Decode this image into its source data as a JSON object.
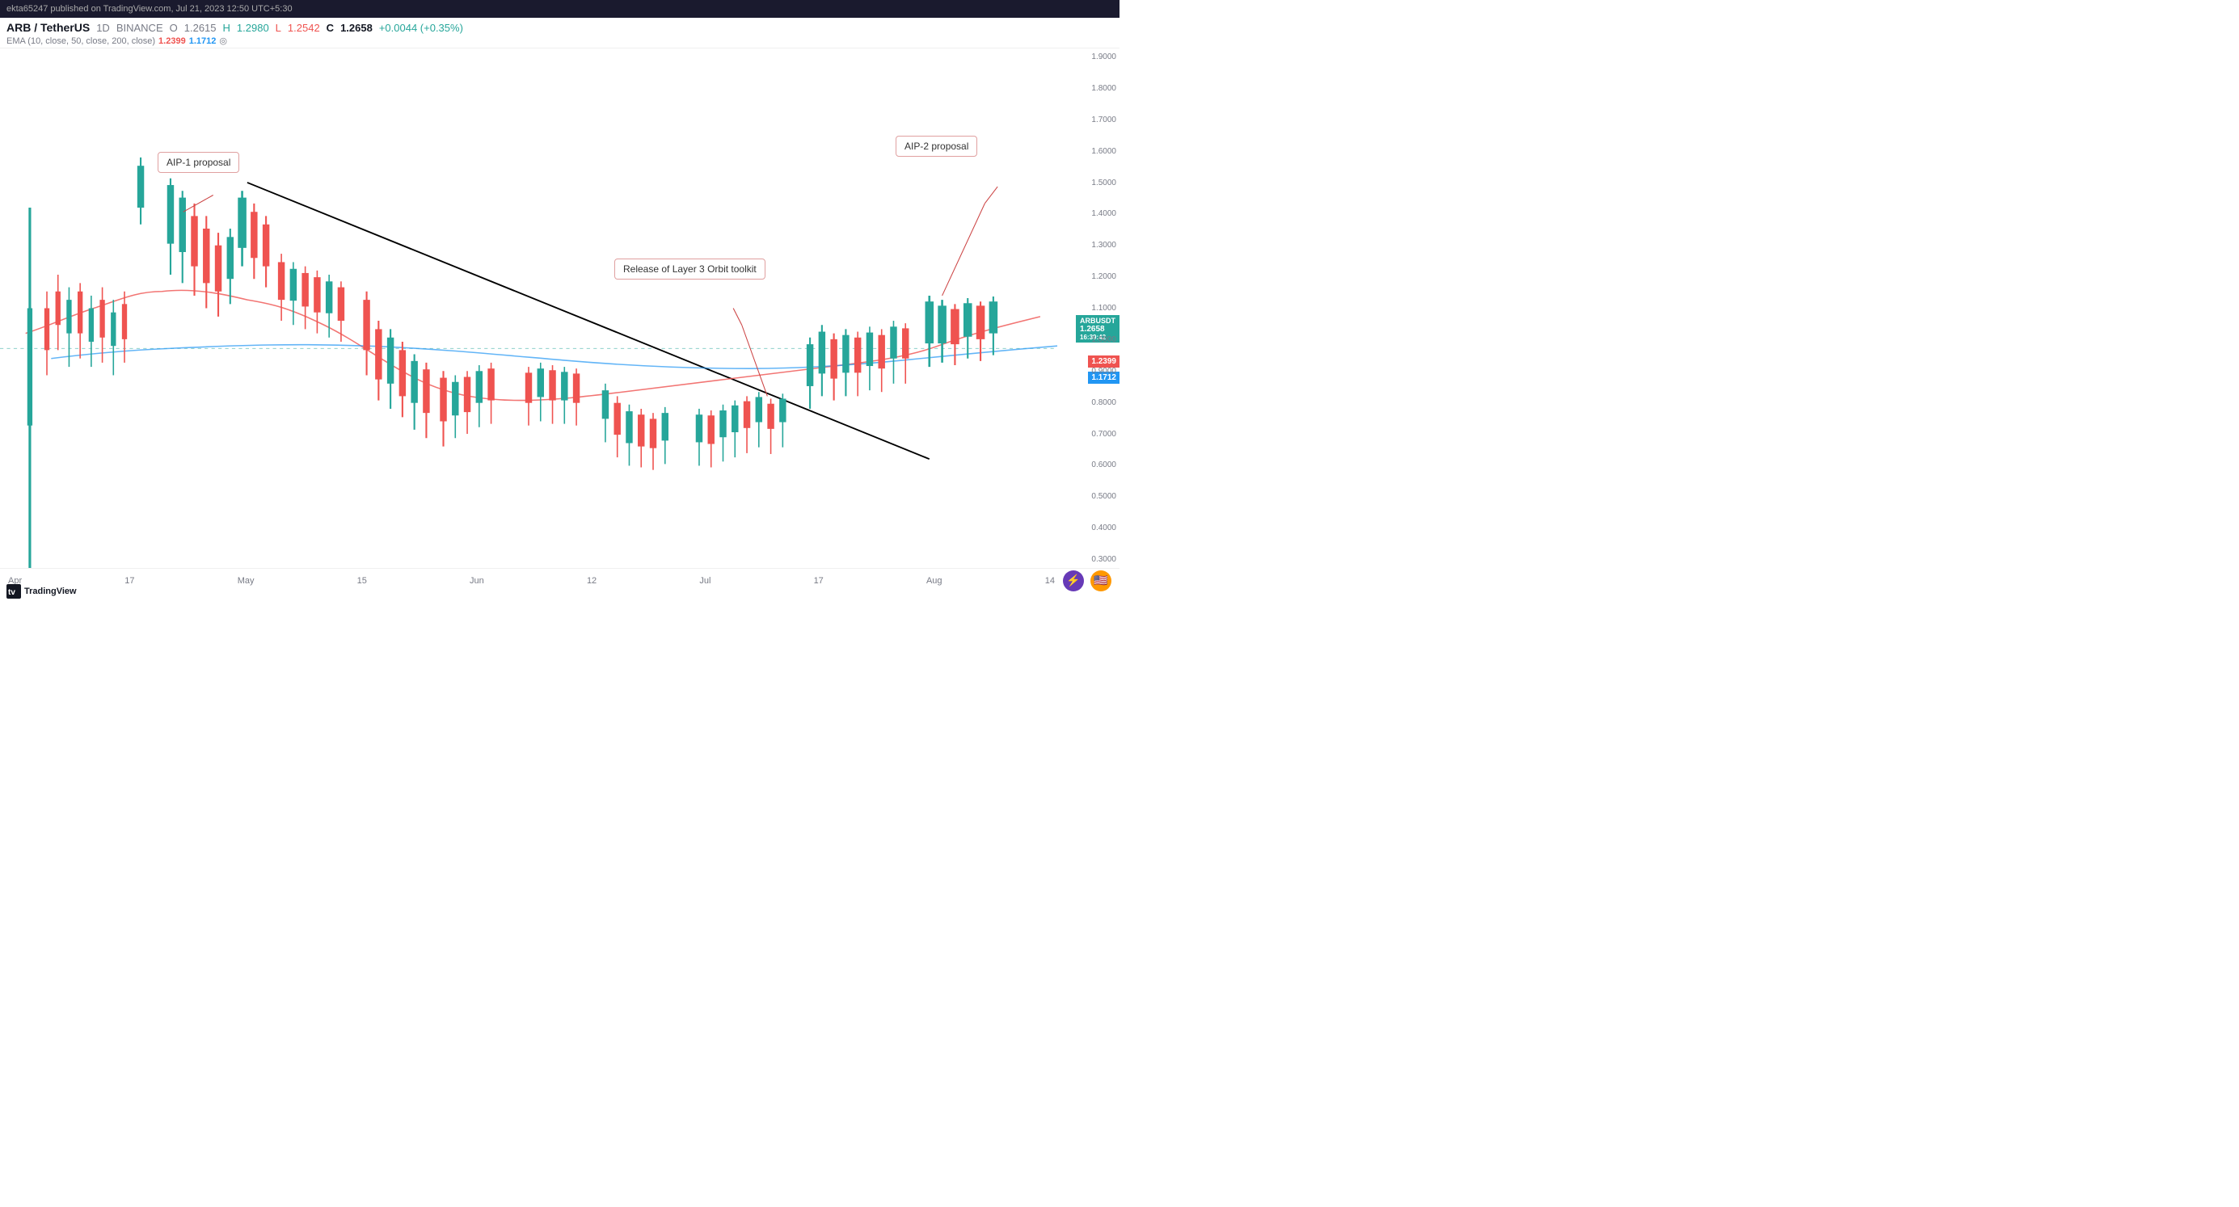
{
  "topbar": {
    "text": "ekta65247 published on TradingView.com, Jul 21, 2023 12:50 UTC+5:30"
  },
  "header": {
    "symbol": "ARB / TetherUS",
    "timeframe": "1D",
    "exchange": "BINANCE",
    "open_label": "O",
    "open_val": "1.2615",
    "high_label": "H",
    "high_val": "1.2980",
    "low_label": "L",
    "low_val": "1.2542",
    "close_label": "C",
    "close_val": "1.2658",
    "change_val": "+0.0044 (+0.35%)",
    "ema_label": "EMA (10, close, 50, close, 200, close)",
    "ema10_val": "1.2399",
    "ema200_val": "1.1712",
    "currency": "USDT"
  },
  "price_axis": {
    "labels": [
      "1.9000",
      "1.8000",
      "1.7000",
      "1.6000",
      "1.5000",
      "1.4000",
      "1.3000",
      "1.2000",
      "1.1000",
      "1.0000",
      "0.9000",
      "0.8000",
      "0.7000",
      "0.6000",
      "0.5000",
      "0.4000",
      "0.3000"
    ]
  },
  "time_axis": {
    "labels": [
      "Apr",
      "17",
      "May",
      "15",
      "Jun",
      "12",
      "Jul",
      "17",
      "Aug",
      "14"
    ]
  },
  "annotations": {
    "aip1": "AIP-1 proposal",
    "orbit": "Release of Layer 3 Orbit toolkit",
    "aip2": "AIP-2 proposal"
  },
  "price_indicators": {
    "arb_label": "ARBUSDT",
    "arb_price": "1.2658",
    "time_val": "16:39:42",
    "ema10": "1.2399",
    "ema200": "1.1712"
  },
  "icons": {
    "lightning": "⚡",
    "flag": "🇺🇸"
  },
  "footer": {
    "tradingview": "TradingView"
  }
}
